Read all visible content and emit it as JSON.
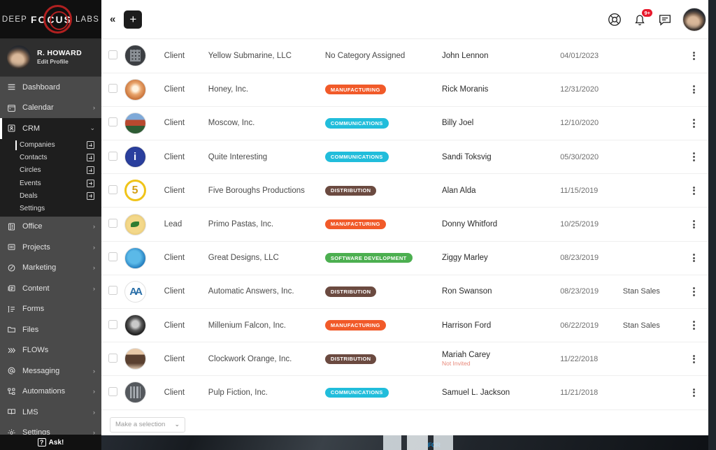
{
  "brand": {
    "word1": "DEEP",
    "word2": "FOCUS",
    "word3": "LABS"
  },
  "profile": {
    "name": "R. HOWARD",
    "edit": "Edit Profile",
    "avatar_icon": "user-avatar"
  },
  "sidebar": {
    "items": [
      {
        "label": "Dashboard",
        "icon": "hamburger-icon",
        "chevron": "",
        "active": false
      },
      {
        "label": "Calendar",
        "icon": "calendar-icon",
        "chevron": "›",
        "active": false
      },
      {
        "label": "CRM",
        "icon": "contact-card-icon",
        "chevron": "⌄",
        "active": true
      },
      {
        "label": "Office",
        "icon": "office-icon",
        "chevron": "›",
        "active": false
      },
      {
        "label": "Projects",
        "icon": "projects-icon",
        "chevron": "›",
        "active": false
      },
      {
        "label": "Marketing",
        "icon": "marketing-icon",
        "chevron": "›",
        "active": false
      },
      {
        "label": "Content",
        "icon": "content-icon",
        "chevron": "›",
        "active": false
      },
      {
        "label": "Forms",
        "icon": "forms-icon",
        "chevron": "",
        "active": false
      },
      {
        "label": "Files",
        "icon": "folder-icon",
        "chevron": "",
        "active": false
      },
      {
        "label": "FLOWs",
        "icon": "chevrons-right-icon",
        "chevron": "",
        "active": false
      },
      {
        "label": "Messaging",
        "icon": "at-sign-icon",
        "chevron": "›",
        "active": false
      },
      {
        "label": "Automations",
        "icon": "automations-icon",
        "chevron": "›",
        "active": false
      },
      {
        "label": "LMS",
        "icon": "book-icon",
        "chevron": "›",
        "active": false
      },
      {
        "label": "Settings",
        "icon": "gear-icon",
        "chevron": "›",
        "active": false
      }
    ],
    "crm_submenu": [
      {
        "label": "Companies",
        "plus": true,
        "current": true
      },
      {
        "label": "Contacts",
        "plus": true,
        "current": false
      },
      {
        "label": "Circles",
        "plus": true,
        "current": false
      },
      {
        "label": "Events",
        "plus": true,
        "current": false
      },
      {
        "label": "Deals",
        "plus": true,
        "current": false
      },
      {
        "label": "Settings",
        "plus": false,
        "current": false
      }
    ],
    "ask_label": "Ask!",
    "ask_icon": "question-mark-icon"
  },
  "topbar": {
    "collapse_label": "«",
    "add_label": "+",
    "help_icon": "lifebuoy-icon",
    "bell_icon": "bell-icon",
    "bell_badge": "9+",
    "chat_icon": "chat-bubble-icon",
    "avatar_icon": "user-avatar"
  },
  "table": {
    "rows": [
      {
        "type": "Client",
        "company": "Yellow Submarine, LLC",
        "category": "No Category Assigned",
        "category_color": "",
        "contact": "John Lennon",
        "sub": "",
        "date": "04/01/2023",
        "owner": "",
        "avatar": "building"
      },
      {
        "type": "Client",
        "company": "Honey, Inc.",
        "category": "MANUFACTURING",
        "category_color": "#f15a29",
        "contact": "Rick Moranis",
        "sub": "",
        "date": "12/31/2020",
        "owner": "",
        "avatar": "honey"
      },
      {
        "type": "Client",
        "company": "Moscow, Inc.",
        "category": "COMMUNICATIONS",
        "category_color": "#21bddb",
        "contact": "Billy Joel",
        "sub": "",
        "date": "12/10/2020",
        "owner": "",
        "avatar": "moscow"
      },
      {
        "type": "Client",
        "company": "Quite Interesting",
        "category": "COMMUNICATIONS",
        "category_color": "#21bddb",
        "contact": "Sandi Toksvig",
        "sub": "",
        "date": "05/30/2020",
        "owner": "",
        "avatar": "quite"
      },
      {
        "type": "Client",
        "company": "Five Boroughs Productions",
        "category": "DISTRIBUTION",
        "category_color": "#6b4a40",
        "contact": "Alan Alda",
        "sub": "",
        "date": "11/15/2019",
        "owner": "",
        "avatar": "five"
      },
      {
        "type": "Lead",
        "company": "Primo Pastas, Inc.",
        "category": "MANUFACTURING",
        "category_color": "#f15a29",
        "contact": "Donny Whitford",
        "sub": "",
        "date": "10/25/2019",
        "owner": "",
        "avatar": "pasta"
      },
      {
        "type": "Client",
        "company": "Great Designs, LLC",
        "category": "SOFTWARE DEVELOPMENT",
        "category_color": "#4caf50",
        "contact": "Ziggy Marley",
        "sub": "",
        "date": "08/23/2019",
        "owner": "",
        "avatar": "design"
      },
      {
        "type": "Client",
        "company": "Automatic Answers, Inc.",
        "category": "DISTRIBUTION",
        "category_color": "#6b4a40",
        "contact": "Ron Swanson",
        "sub": "",
        "date": "08/23/2019",
        "owner": "Stan Sales",
        "avatar": "aa"
      },
      {
        "type": "Client",
        "company": "Millenium Falcon, Inc.",
        "category": "MANUFACTURING",
        "category_color": "#f15a29",
        "contact": "Harrison Ford",
        "sub": "",
        "date": "06/22/2019",
        "owner": "Stan Sales",
        "avatar": "falcon"
      },
      {
        "type": "Client",
        "company": "Clockwork Orange, Inc.",
        "category": "DISTRIBUTION",
        "category_color": "#6b4a40",
        "contact": "Mariah Carey",
        "sub": "Not Invited",
        "date": "11/22/2018",
        "owner": "",
        "avatar": "clock"
      },
      {
        "type": "Client",
        "company": "Pulp Fiction, Inc.",
        "category": "COMMUNICATIONS",
        "category_color": "#21bddb",
        "contact": "Samuel L. Jackson",
        "sub": "",
        "date": "11/21/2018",
        "owner": "",
        "avatar": "building2"
      }
    ],
    "bulk_select_placeholder": "Make a selection",
    "bulk_caret": "⌄",
    "row_menu_icon": "kebab-menu-icon"
  }
}
